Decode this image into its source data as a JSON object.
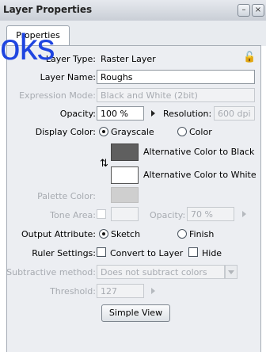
{
  "window": {
    "title": "Layer Properties",
    "minimize_glyph": "–",
    "close_glyph": "×"
  },
  "tabs": [
    "Properties"
  ],
  "overlay_text": "oks",
  "form": {
    "layer_type_label": "Layer Type:",
    "layer_type_value": "Raster Layer",
    "layer_name_label": "Layer Name:",
    "layer_name_value": "Roughs",
    "expression_mode_label": "Expression Mode:",
    "expression_mode_value": "Black and White (2bit)",
    "opacity_label": "Opacity:",
    "opacity_value": "100 %",
    "resolution_label": "Resolution:",
    "resolution_value": "600 dpi",
    "display_color_label": "Display Color:",
    "display_color_options": [
      "Grayscale",
      "Color"
    ],
    "display_color_selected": "Grayscale",
    "alt_black_label": "Alternative Color to Black",
    "alt_white_label": "Alternative Color to White",
    "alt_black_color": "#5f5f5f",
    "alt_white_color": "#ffffff",
    "palette_color_label": "Palette Color:",
    "palette_color": "#cfcfcf",
    "tone_area_label": "Tone Area:",
    "tone_opacity_label": "Opacity:",
    "tone_opacity_value": "70 %",
    "output_attribute_label": "Output Attribute:",
    "output_options": [
      "Sketch",
      "Finish"
    ],
    "output_selected": "Sketch",
    "ruler_settings_label": "Ruler Settings:",
    "ruler_options": [
      "Convert to Layer",
      "Hide"
    ],
    "subtractive_label": "Subtractive method:",
    "subtractive_value": "Does not subtract colors",
    "threshold_label": "Threshold:",
    "threshold_value": "127",
    "simple_view_button": "Simple View"
  },
  "colors": {
    "accent_overlay": "#1f45e0",
    "panel_bg": "#eceef2",
    "disabled_text": "#a7abb1"
  },
  "icons": [
    "lock-icon",
    "link-swap-icon",
    "minimize-icon",
    "close-icon"
  ]
}
